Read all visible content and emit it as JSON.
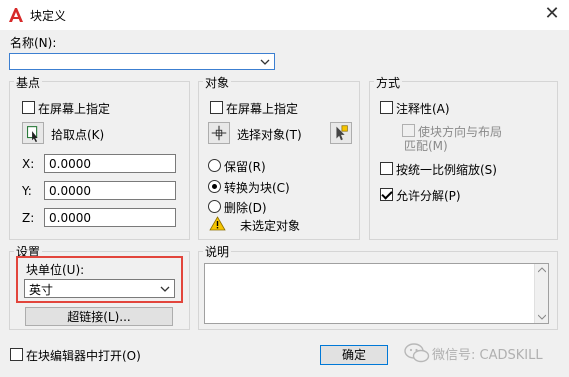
{
  "window": {
    "title": "块定义",
    "close_glyph": "✕",
    "icon": "autocad-a-icon"
  },
  "name_field": {
    "label": "名称(N):",
    "value": ""
  },
  "base_point": {
    "title": "基点",
    "specify_on_screen": "在屏幕上指定",
    "pick_point": "拾取点(K)",
    "x_label": "X:",
    "x_value": "0.0000",
    "y_label": "Y:",
    "y_value": "0.0000",
    "z_label": "Z:",
    "z_value": "0.0000"
  },
  "objects": {
    "title": "对象",
    "specify_on_screen": "在屏幕上指定",
    "select_objects": "选择对象(T)",
    "retain": "保留(R)",
    "convert_to_block": "转换为块(C)",
    "delete": "删除(D)",
    "warning": "未选定对象",
    "selected_option": "convert_to_block"
  },
  "behavior": {
    "title": "方式",
    "annotative": "注释性(A)",
    "match_orientation_line1": "使块方向与布局",
    "match_orientation_line2": "匹配(M)",
    "scale_uniformly": "按统一比例缩放(S)",
    "allow_exploding": "允许分解(P)",
    "allow_exploding_checked": true
  },
  "settings": {
    "title": "设置",
    "block_unit_label": "块单位(U):",
    "block_unit_value": "英寸",
    "hyperlink_button": "超链接(L)..."
  },
  "description": {
    "title": "说明",
    "value": ""
  },
  "footer": {
    "open_in_editor": "在块编辑器中打开(O)",
    "ok_button": "确定"
  },
  "watermark": {
    "text": "微信号: CADSKILL"
  },
  "colors": {
    "accent_red": "#e2453c",
    "focus_blue": "#3c7fd1",
    "warning_yellow": "#f5c400"
  }
}
